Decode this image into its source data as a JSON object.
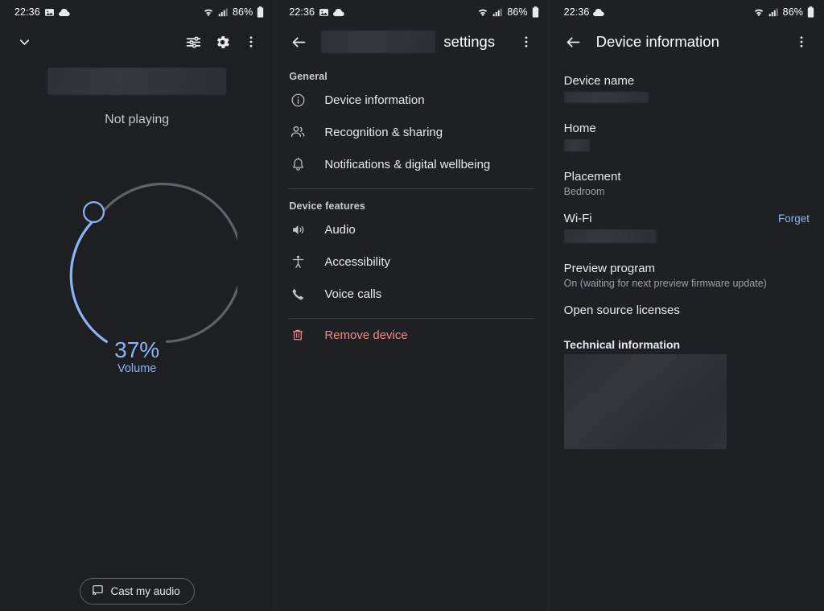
{
  "statusbar": {
    "time": "22:36",
    "battery_text": "86%",
    "icons_left_p1": [
      "image-icon",
      "cloud-icon"
    ],
    "icons_left_p3": [
      "cloud-icon"
    ],
    "icons_right": [
      "wifi-icon",
      "signal-icon",
      "battery-icon"
    ]
  },
  "panel_media": {
    "appbar": {
      "collapse_icon": "chevron-down-icon",
      "equalizer_icon": "equalizer-icon",
      "settings_icon": "gear-icon",
      "overflow_icon": "more-vertical-icon"
    },
    "device_title_redacted": "",
    "playback_status": "Not playing",
    "volume": {
      "percent_label": "37%",
      "label": "Volume",
      "value": 37,
      "track_color": "#5f6368",
      "active_color": "#8ab4f8"
    },
    "cast_button": {
      "label": "Cast my audio",
      "icon": "cast-icon"
    }
  },
  "panel_settings": {
    "appbar": {
      "back_icon": "arrow-back-icon",
      "title_redacted_prefix": "",
      "title_suffix": "settings",
      "overflow_icon": "more-vertical-icon"
    },
    "sections": [
      {
        "heading": "General",
        "items": [
          {
            "label": "Device information",
            "icon": "info-circle-icon"
          },
          {
            "label": "Recognition & sharing",
            "icon": "people-icon"
          },
          {
            "label": "Notifications & digital wellbeing",
            "icon": "bell-icon"
          }
        ]
      },
      {
        "heading": "Device features",
        "items": [
          {
            "label": "Audio",
            "icon": "speaker-icon"
          },
          {
            "label": "Accessibility",
            "icon": "accessibility-icon"
          },
          {
            "label": "Voice calls",
            "icon": "phone-icon"
          }
        ]
      }
    ],
    "remove_device": {
      "label": "Remove device",
      "icon": "trash-icon",
      "color": "#f28b82"
    }
  },
  "panel_device_info": {
    "appbar": {
      "back_icon": "arrow-back-icon",
      "title": "Device information",
      "overflow_icon": "more-vertical-icon"
    },
    "rows": [
      {
        "label": "Device name",
        "value_redacted": true,
        "value": ""
      },
      {
        "label": "Home",
        "value_redacted": true,
        "value": ""
      },
      {
        "label": "Placement",
        "value": "Bedroom"
      },
      {
        "label": "Wi-Fi",
        "value_redacted": true,
        "value": "",
        "action": "Forget"
      },
      {
        "label": "Preview program",
        "value": "On (waiting for next preview firmware update)"
      },
      {
        "label": "Open source licenses",
        "value": ""
      }
    ],
    "technical_information": {
      "heading": "Technical information",
      "body_redacted": true
    },
    "link_color": "#8ab4f8"
  }
}
